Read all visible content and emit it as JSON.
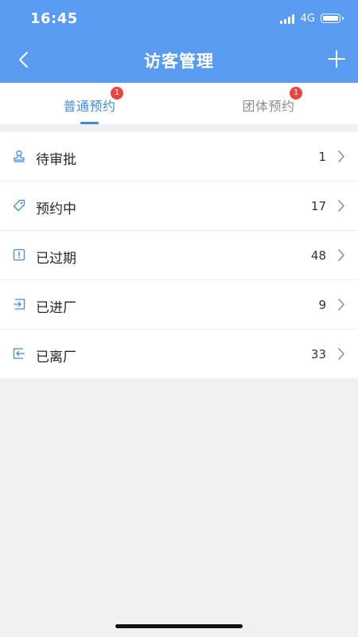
{
  "status_bar": {
    "time": "16:45",
    "network": "4G"
  },
  "nav": {
    "title": "访客管理",
    "back_icon": "chevron-left-icon",
    "add_icon": "plus-icon"
  },
  "tabs": [
    {
      "label": "普通预约",
      "badge": "1",
      "active": true
    },
    {
      "label": "团体预约",
      "badge": "1",
      "active": false
    }
  ],
  "list": {
    "items": [
      {
        "label": "待审批",
        "count": "1",
        "icon": "stamp-icon"
      },
      {
        "label": "预约中",
        "count": "17",
        "icon": "tag-icon"
      },
      {
        "label": "已过期",
        "count": "48",
        "icon": "alert-icon"
      },
      {
        "label": "已进厂",
        "count": "9",
        "icon": "enter-icon"
      },
      {
        "label": "已离厂",
        "count": "33",
        "icon": "exit-icon"
      }
    ]
  },
  "colors": {
    "header": "#5a9bf2",
    "accent": "#3f8ae6",
    "badge": "#e8453c",
    "background": "#efeff4"
  }
}
